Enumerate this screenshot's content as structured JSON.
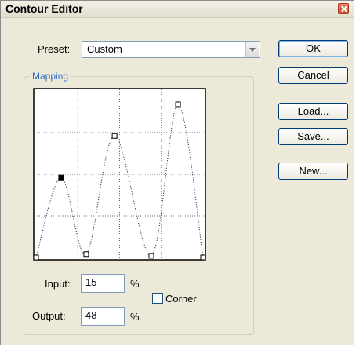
{
  "window": {
    "title": "Contour Editor"
  },
  "preset": {
    "label": "Preset:",
    "value": "Custom"
  },
  "mapping": {
    "title": "Mapping"
  },
  "input": {
    "label": "Input:",
    "value": "15",
    "unit": "%"
  },
  "output": {
    "label": "Output:",
    "value": "48",
    "unit": "%"
  },
  "corner": {
    "label": "Corner",
    "checked": false
  },
  "buttons": {
    "ok": "OK",
    "cancel": "Cancel",
    "load": "Load...",
    "save": "Save...",
    "new": "New..."
  },
  "curve": {
    "grid_divisions": 4,
    "points": [
      {
        "in": 0,
        "out": 0
      },
      {
        "in": 15,
        "out": 48
      },
      {
        "in": 30,
        "out": 2
      },
      {
        "in": 47,
        "out": 73
      },
      {
        "in": 69,
        "out": 1
      },
      {
        "in": 85,
        "out": 92
      },
      {
        "in": 100,
        "out": 0
      }
    ],
    "selected_index": 1,
    "colors": {
      "curve": "#333333",
      "grid": "#6a6a6a",
      "plot_bg": "#ffffff"
    }
  }
}
